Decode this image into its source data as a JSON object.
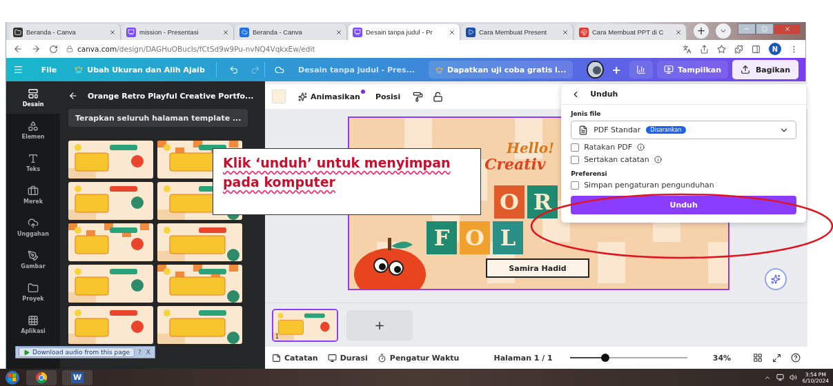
{
  "browser": {
    "tabs": [
      {
        "title": "Beranda - Canva",
        "selected": false
      },
      {
        "title": "mission - Presentasi",
        "selected": false
      },
      {
        "title": "Beranda - Canva",
        "selected": false
      },
      {
        "title": "Desain tanpa judul - Pr",
        "selected": true
      },
      {
        "title": "Cara Membuat Present",
        "selected": false
      },
      {
        "title": "Cara Membuat PPT di C",
        "selected": false
      }
    ],
    "new_tab": "+",
    "url_host": "canva.com",
    "url_path": "/design/DAGHuOBucIs/fCtSd9w9Pu-nvNQ4VqkxEw/edit",
    "profile": "N"
  },
  "header": {
    "menu": "File",
    "resize": "Ubah Ukuran dan Alih Ajaib",
    "doc_title": "Desain tanpa judul - Pres...",
    "trial": "Dapatkan uji coba gratis l...",
    "add": "+",
    "present": "Tampilkan",
    "share": "Bagikan"
  },
  "rail": [
    {
      "label": "Desain",
      "selected": true
    },
    {
      "label": "Elemen",
      "selected": false
    },
    {
      "label": "Teks",
      "selected": false
    },
    {
      "label": "Merek",
      "selected": false
    },
    {
      "label": "Unggahan",
      "selected": false
    },
    {
      "label": "Gambar",
      "selected": false
    },
    {
      "label": "Proyek",
      "selected": false
    },
    {
      "label": "Aplikasi",
      "selected": false
    }
  ],
  "panel": {
    "title": "Orange Retro Playful Creative Portfo...",
    "apply": "Terapkan seluruh halaman template ..."
  },
  "toolbar": {
    "animate": "Animasikan",
    "position": "Posisi"
  },
  "slide": {
    "greeting": "Hello!",
    "headline": "Creativ",
    "tile_rows": [
      [
        "O",
        "R"
      ],
      [
        "F",
        "O",
        "L"
      ]
    ],
    "name": "Samira Hadid"
  },
  "download": {
    "title": "Unduh",
    "file_type_label": "Jenis file",
    "file_type": "PDF Standar",
    "badge": "Disarankan",
    "options": [
      {
        "label": "Ratakan PDF",
        "checked": false
      },
      {
        "label": "Sertakan catatan",
        "checked": false
      }
    ],
    "preferences_label": "Preferensi",
    "save_preference": {
      "label": "Simpan pengaturan pengunduhan",
      "checked": false
    },
    "button": "Unduh"
  },
  "pages": {
    "page_number": "1",
    "add": "+"
  },
  "footer": {
    "notes": "Catatan",
    "duration": "Durasi",
    "timer": "Pengatur Waktu",
    "page": "Halaman 1 / 1",
    "zoom": {
      "level": 0.3
    },
    "zoom_reading": "34%"
  },
  "callout": {
    "lines": [
      "Klik ‘unduh’ untuk menyimpan",
      "pada komputer"
    ]
  },
  "audio_bar": {
    "text": "Download audio from this page",
    "help": "?",
    "close": "X"
  },
  "taskbar": {
    "word": "W",
    "time": "3:54 PM",
    "date": "6/10/2024"
  }
}
